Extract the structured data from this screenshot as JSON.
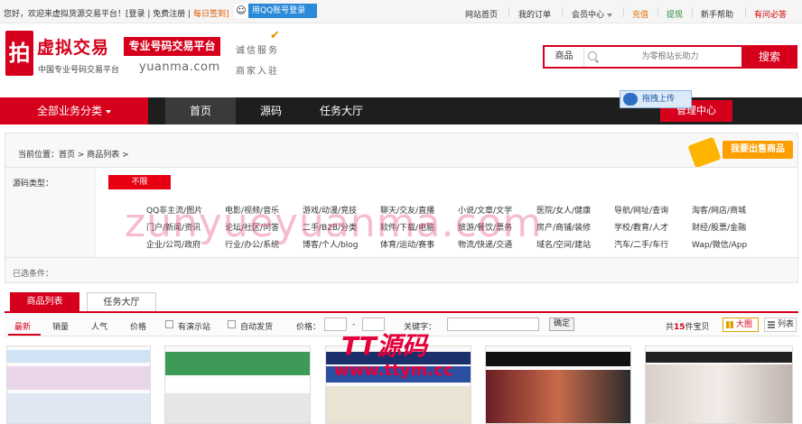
{
  "topbar": {
    "welcome": "您好，欢迎来虚拟货源交易平台！[登录 | 免费注册 |",
    "checkin": "每日签到]",
    "qq_login": "用QQ账号登录",
    "links": [
      "网站首页",
      "我的订单",
      "会员中心",
      "充值",
      "提现",
      "新手帮助",
      "有问必答"
    ]
  },
  "header": {
    "logo_mark": "拍",
    "logo_title": "虚拟交易",
    "logo_badge": "专业号码交易平台",
    "logo_sub": "中国专业号码交易平台",
    "logo_domain": "yuanma.com",
    "slogan1": "诚信服务",
    "slogan2": "商家入驻",
    "search": {
      "category": "商品",
      "placeholder": "为零根站长助力",
      "button": "搜索"
    }
  },
  "nav": {
    "all": "全部业务分类",
    "items": [
      "首页",
      "源码",
      "任务大厅"
    ],
    "admin": "管理中心",
    "drag_upload": "拖拽上传"
  },
  "breadcrumb": {
    "text": "当前位置：首页 > 商品列表 >",
    "sell": "我要出售商品"
  },
  "filter": {
    "label": "源码类型：",
    "all": "不限",
    "categories": [
      [
        "QQ非主流/图片",
        "电影/视频/音乐",
        "游戏/动漫/竞技",
        "聊天/交友/直播",
        "小说/文章/文学",
        "医院/女人/健康",
        "导航/网址/查询",
        "淘客/网店/商城"
      ],
      [
        "门户/新闻/资讯",
        "论坛/社区/问答",
        "二手/B2B/分类",
        "软件/下载/电脑",
        "旅游/餐饮/票务",
        "房产/商铺/装修",
        "学校/教育/人才",
        "财经/股票/金融"
      ],
      [
        "企业/公司/政府",
        "行业/办公/系统",
        "博客/个人/blog",
        "体育/运动/赛事",
        "物流/快递/交通",
        "域名/空间/建站",
        "汽车/二手/车行",
        "Wap/微信/App"
      ]
    ],
    "selected_label": "已选条件："
  },
  "tabs": [
    "商品列表",
    "任务大厅"
  ],
  "sortbar": {
    "sorts": [
      "最新",
      "销量",
      "人气",
      "价格"
    ],
    "checks": [
      "有演示站",
      "自动发货"
    ],
    "price_label": "价格：",
    "dash": "-",
    "keyword_label": "关键字：",
    "confirm": "确定",
    "total_prefix": "共",
    "total_count": "15",
    "total_suffix": "件宝贝",
    "view_big": "大图",
    "view_list": "列表"
  },
  "watermarks": {
    "main": "zunyueyuanma.com",
    "tt": "TT源码",
    "tt_url": "www.ttym.cc"
  }
}
